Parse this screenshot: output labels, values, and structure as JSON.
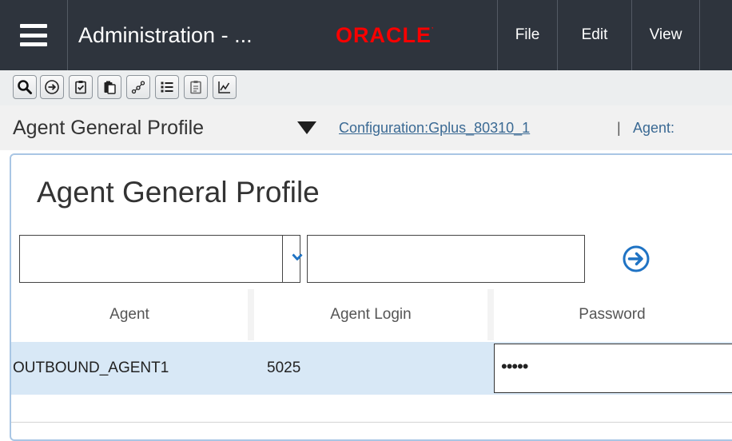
{
  "titlebar": {
    "title": "Administration - ...",
    "brand": "ORACLE",
    "brand_color": "#f80000",
    "background": "#2e343d",
    "menu": [
      {
        "label": "File"
      },
      {
        "label": "Edit"
      },
      {
        "label": "View"
      }
    ]
  },
  "toolbar": {
    "buttons": [
      {
        "icon": "search-icon"
      },
      {
        "icon": "go-arrow-icon"
      },
      {
        "icon": "checklist-icon"
      },
      {
        "icon": "paste-icon"
      },
      {
        "icon": "network-icon"
      },
      {
        "icon": "list-icon"
      },
      {
        "icon": "clipboard-icon"
      },
      {
        "icon": "chart-icon"
      }
    ]
  },
  "breadcrumb": {
    "title": "Agent General Profile",
    "link": "Configuration:Gplus_80310_1",
    "separator": "|",
    "agent_link": "Agent:"
  },
  "panel": {
    "title": "Agent General Profile",
    "filter": {
      "select_value": "",
      "input_value": ""
    },
    "columns": [
      "Agent",
      "Agent Login",
      "Password"
    ],
    "rows": [
      {
        "agent": "OUTBOUND_AGENT1",
        "agent_login": "5025",
        "password": "•••••"
      }
    ],
    "accent_color": "#1f73c4",
    "selected_row_color": "#d8e8f6"
  }
}
